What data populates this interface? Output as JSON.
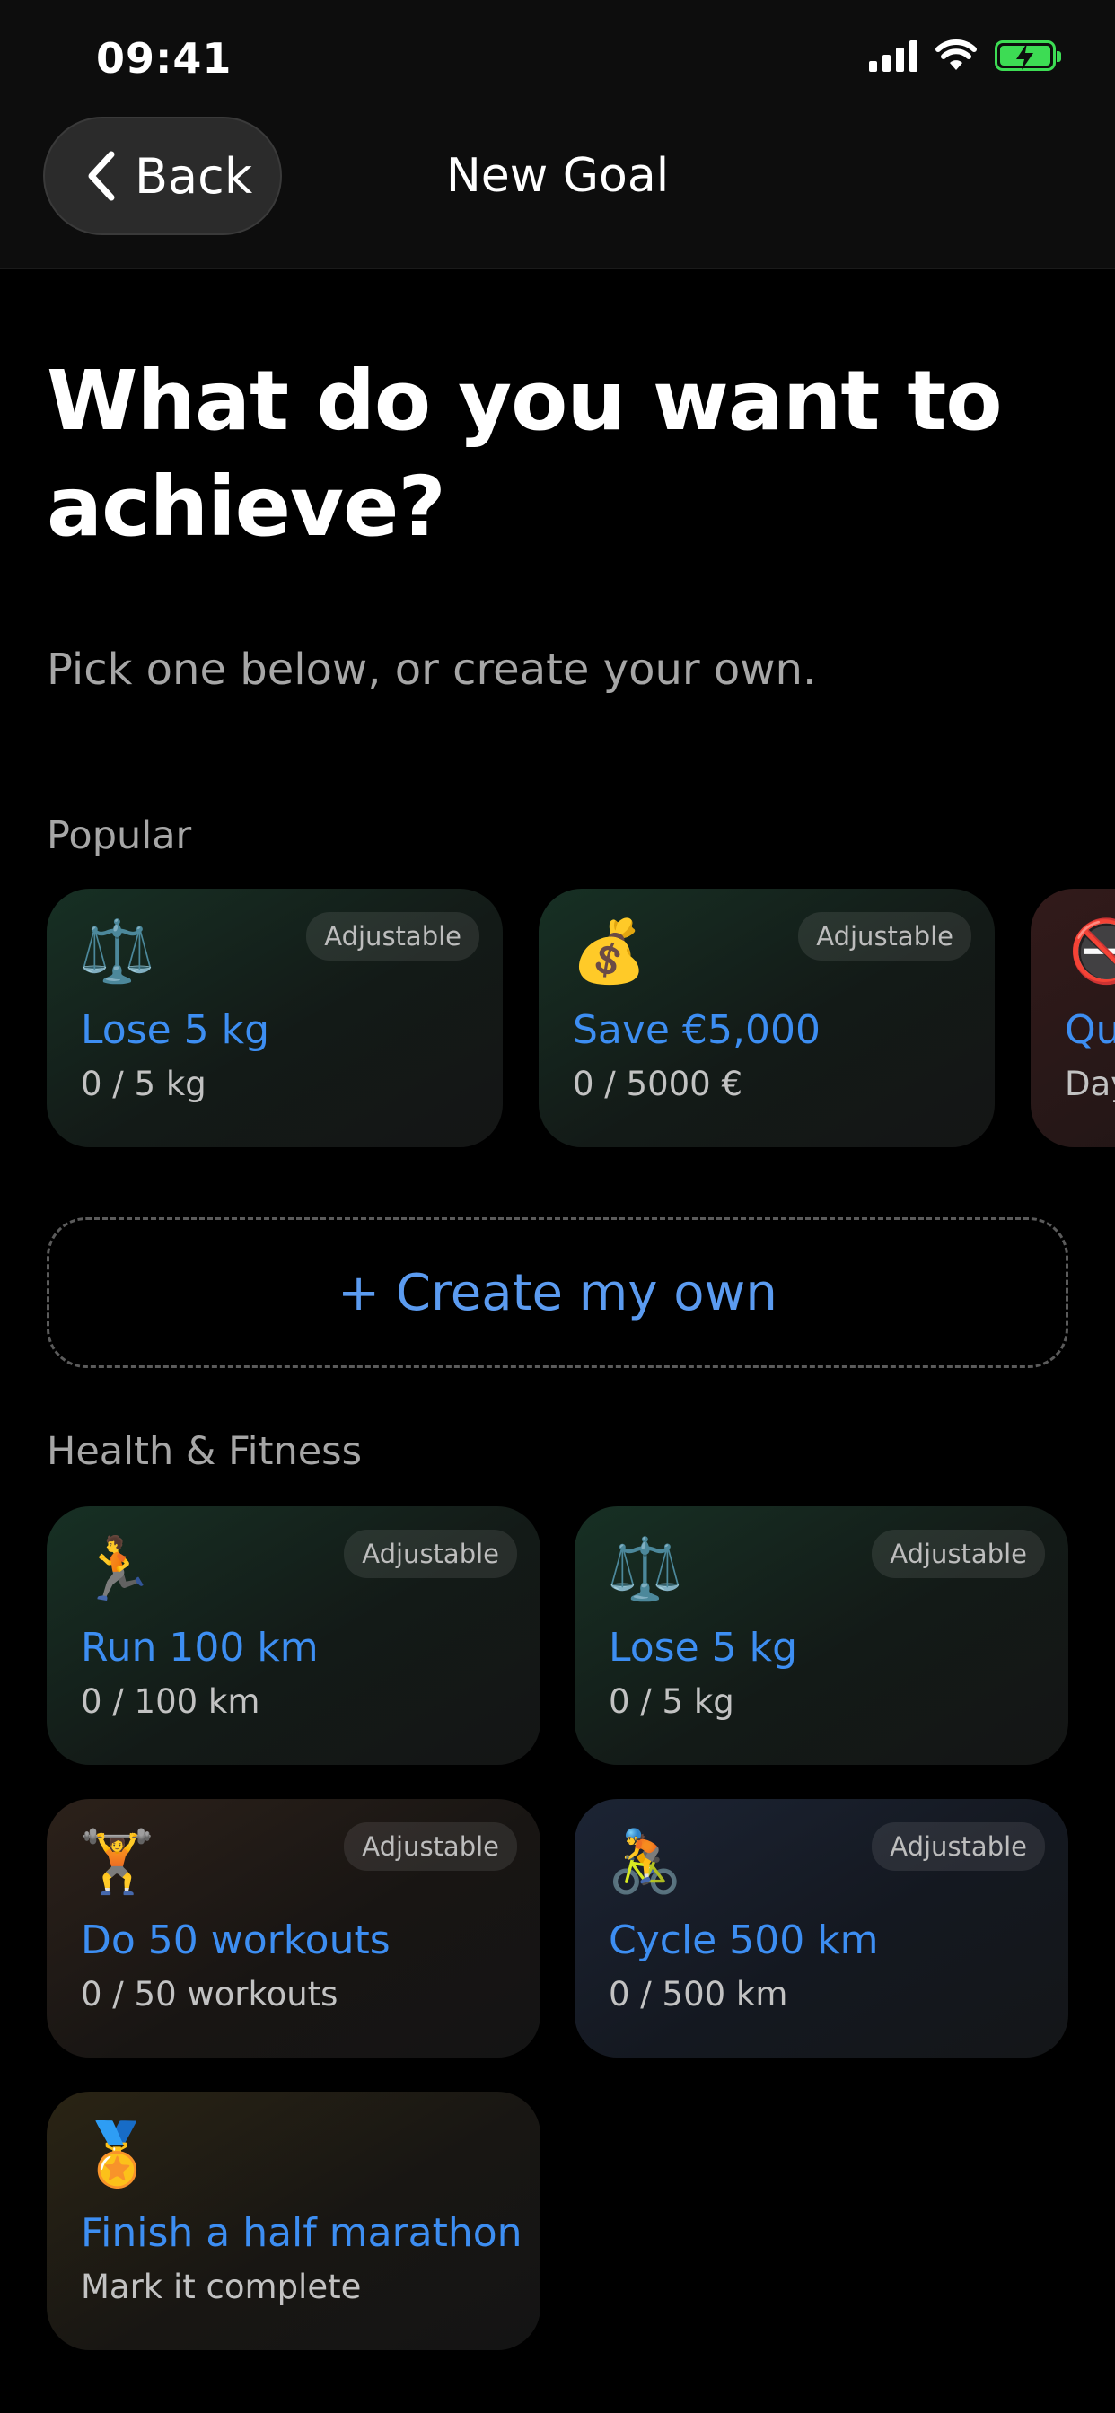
{
  "status_bar": {
    "time": "09:41",
    "icons": [
      "signal-icon",
      "wifi-icon",
      "battery-charging-icon"
    ],
    "battery_color": "#3ddc54"
  },
  "nav": {
    "back_label": "Back",
    "title": "New Goal"
  },
  "headline": "What do you want to achieve?",
  "subtitle": "Pick one below, or create your own.",
  "popular": {
    "label": "Popular",
    "cards": [
      {
        "emoji": "⚖️",
        "icon": "scale-icon",
        "badge": "Adjustable",
        "title": "Lose 5 kg",
        "progress": "0 / 5 kg"
      },
      {
        "emoji": "💰",
        "icon": "money-bag-icon",
        "badge": "Adjustable",
        "title": "Save €5,000",
        "progress": "0 / 5000 €"
      },
      {
        "emoji": "🚭",
        "icon": "no-smoking-icon",
        "badge": "",
        "title": "Qu",
        "progress": "Day"
      }
    ]
  },
  "create_own_label": "+ Create my own",
  "health": {
    "label": "Health & Fitness",
    "cards": [
      {
        "emoji": "🏃",
        "icon": "runner-icon",
        "badge": "Adjustable",
        "title": "Run 100 km",
        "progress": "0 / 100 km"
      },
      {
        "emoji": "⚖️",
        "icon": "scale-icon",
        "badge": "Adjustable",
        "title": "Lose 5 kg",
        "progress": "0 / 5 kg"
      },
      {
        "emoji": "🏋️",
        "icon": "weightlifter-icon",
        "badge": "Adjustable",
        "title": "Do 50 workouts",
        "progress": "0 / 50 workouts"
      },
      {
        "emoji": "🚴",
        "icon": "cyclist-icon",
        "badge": "Adjustable",
        "title": "Cycle 500 km",
        "progress": "0 / 500 km"
      },
      {
        "emoji": "🏅",
        "icon": "medal-icon",
        "badge": "",
        "title": "Finish a half marathon",
        "progress": "Mark it complete"
      }
    ]
  },
  "colors": {
    "accent": "#3d8ef2",
    "background": "#000000",
    "secondary_text": "#a6a6a6"
  }
}
